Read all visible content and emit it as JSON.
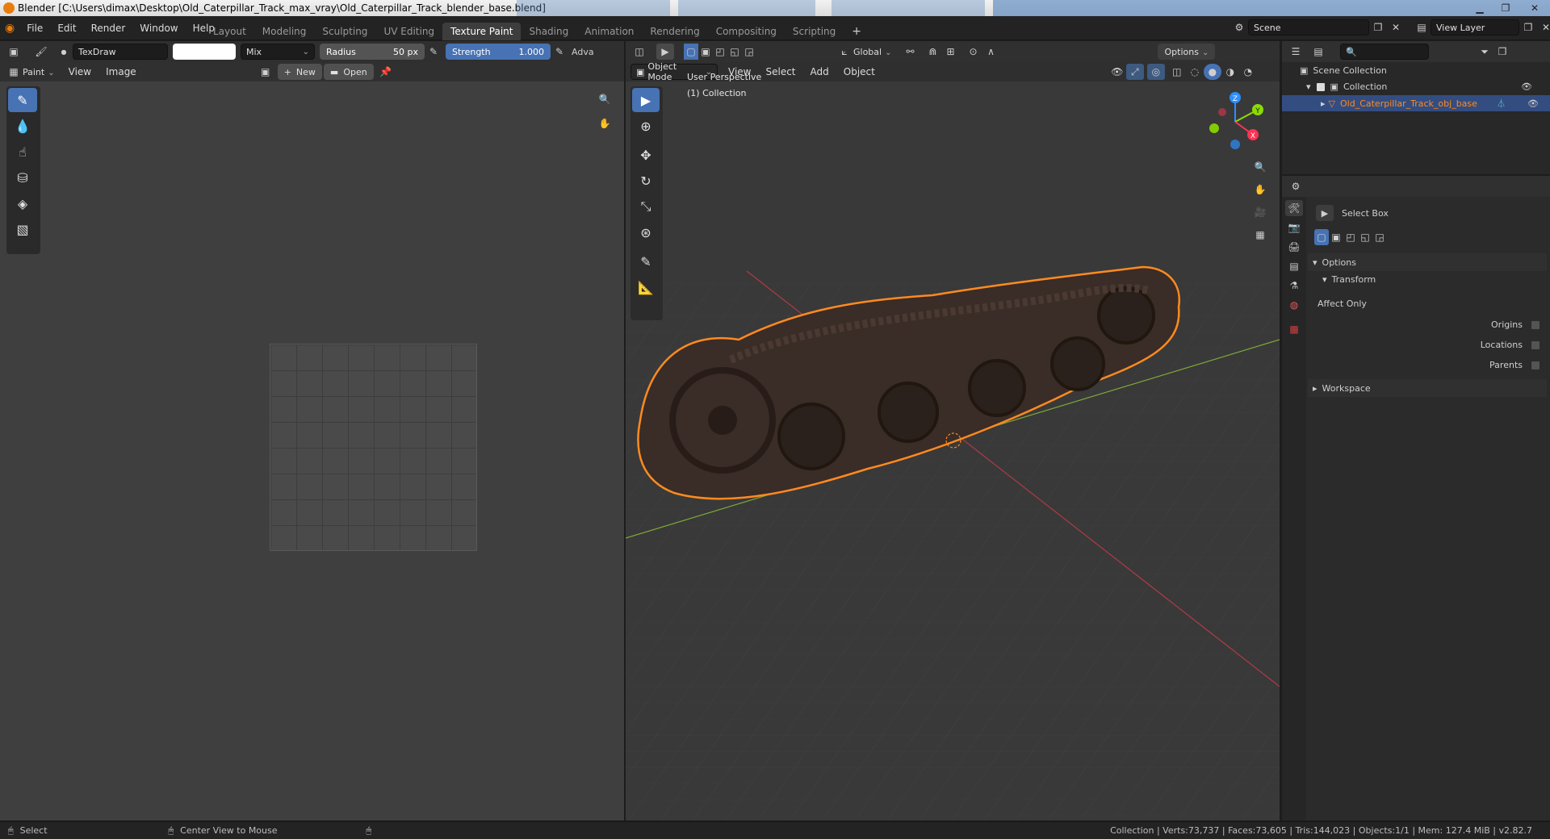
{
  "window": {
    "title": "Blender [C:\\Users\\dimax\\Desktop\\Old_Caterpillar_Track_max_vray\\Old_Caterpillar_Track_blender_base.blend]",
    "controls": [
      "minimize-icon",
      "maximize-icon",
      "close-icon"
    ]
  },
  "menu": [
    "File",
    "Edit",
    "Render",
    "Window",
    "Help"
  ],
  "workspaces": [
    "Layout",
    "Modeling",
    "Sculpting",
    "UV Editing",
    "Texture Paint",
    "Shading",
    "Animation",
    "Rendering",
    "Compositing",
    "Scripting"
  ],
  "active_workspace": "Texture Paint",
  "scene_label": "Scene",
  "view_layer_label": "View Layer",
  "image_editor": {
    "brush_name": "TexDraw",
    "blend_mode": "Mix",
    "radius_label": "Radius",
    "radius_value": "50 px",
    "strength_label": "Strength",
    "strength_value": "1.000",
    "adv_label": "Adva",
    "mode": "Paint",
    "menus": [
      "View",
      "Image"
    ],
    "new_label": "New",
    "open_label": "Open"
  },
  "viewport": {
    "mode": "Object Mode",
    "menus": [
      "View",
      "Select",
      "Add",
      "Object"
    ],
    "orientation": "Global",
    "options_label": "Options",
    "overlay_line1": "User Perspective",
    "overlay_line2": "(1) Collection",
    "axes": {
      "x": "X",
      "y": "Y",
      "z": "Z"
    },
    "colors": {
      "x": "#ff3352",
      "y": "#8bdc00",
      "z": "#2c8fff",
      "selection": "#ff8a20"
    }
  },
  "outliner": {
    "scene_collection": "Scene Collection",
    "collection": "Collection",
    "object": "Old_Caterpillar_Track_obj_base"
  },
  "properties": {
    "tool_name": "Select Box",
    "options_label": "Options",
    "transform_label": "Transform",
    "affect_only_label": "Affect Only",
    "origins_label": "Origins",
    "locations_label": "Locations",
    "parents_label": "Parents",
    "workspace_label": "Workspace"
  },
  "statusbar": {
    "left_action": "Select",
    "middle_action": "Center View to Mouse",
    "stats": "Collection | Verts:73,737 | Faces:73,605 | Tris:144,023 | Objects:1/1 | Mem: 127.4 MiB | v2.82.7"
  }
}
